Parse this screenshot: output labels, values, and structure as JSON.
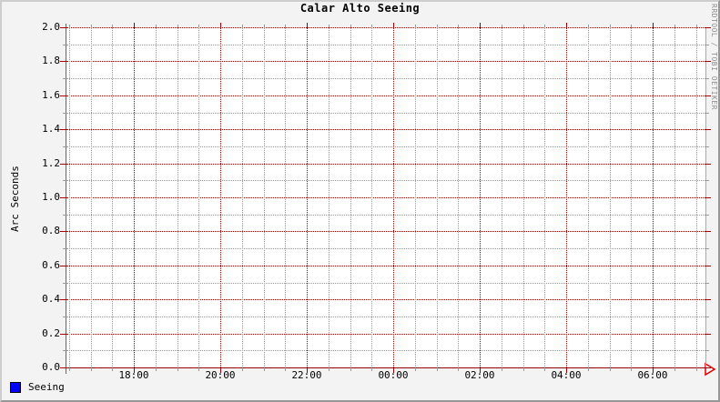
{
  "chart_data": {
    "type": "line",
    "title": "Calar Alto Seeing",
    "ylabel": "Arc Seconds",
    "xlabel": "",
    "ylim": [
      0.0,
      2.0
    ],
    "y_ticks": [
      "0.0",
      "0.2",
      "0.4",
      "0.6",
      "0.8",
      "1.0",
      "1.2",
      "1.4",
      "1.6",
      "1.8",
      "2.0"
    ],
    "x_ticks": [
      "18:00",
      "20:00",
      "22:00",
      "00:00",
      "02:00",
      "04:00",
      "06:00"
    ],
    "grid": true,
    "legend_position": "bottom-left",
    "series": [
      {
        "name": "Seeing",
        "color": "#0000ff",
        "values": []
      }
    ]
  },
  "watermark": "RRDTOOL / TOBI OETIKER",
  "colors": {
    "background": "#f3f3f3",
    "canvas": "#ffffff",
    "major_grid": "#a00000",
    "minor_grid": "#9a9a9a",
    "axis_y": "#666666",
    "axis_x": "#222222",
    "plot_right_edge": "#aaaaaa",
    "arrow": "#e00000",
    "border_light": "#cdcdcd",
    "border_dark": "#979797",
    "text": "#000000",
    "watermark_text": "#909090",
    "legend_swatch": "#0000ff"
  }
}
